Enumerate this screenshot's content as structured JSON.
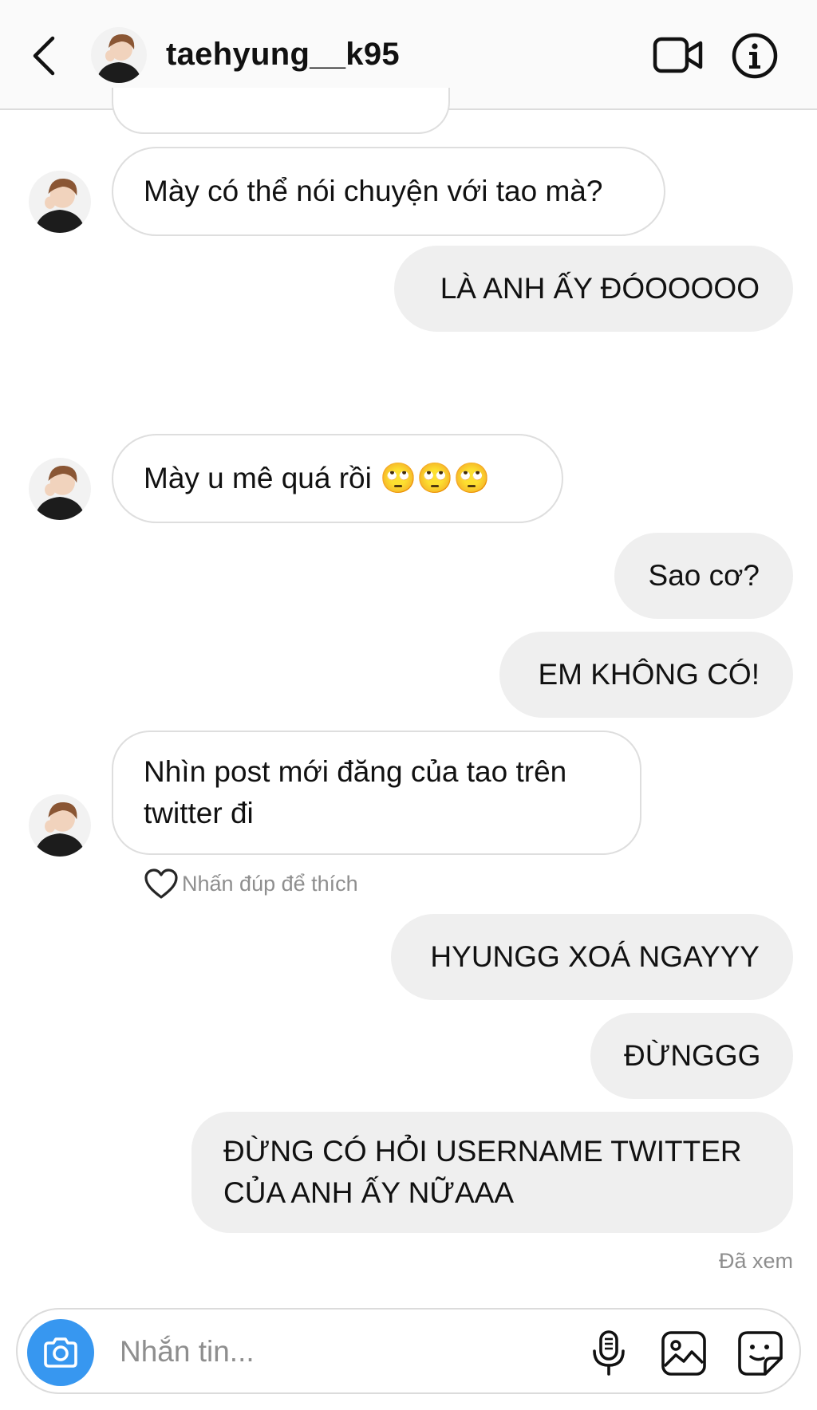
{
  "header": {
    "username": "taehyung__k95"
  },
  "messages": [
    {
      "direction": "in",
      "text": "Mày có thể nói chuyện với tao mà?"
    },
    {
      "direction": "out",
      "text": "LÀ ANH ẤY ĐÓOOOOO"
    },
    {
      "direction": "in",
      "text": "Mày u mê quá rồi 🙄🙄🙄"
    },
    {
      "direction": "out",
      "text": "Sao cơ?"
    },
    {
      "direction": "out",
      "text": "EM KHÔNG CÓ!"
    },
    {
      "direction": "in",
      "line1": "Nhìn post mới đăng của tao trên",
      "line2": "twitter đi"
    },
    {
      "direction": "out",
      "text": "HYUNGG XOÁ NGAYYY"
    },
    {
      "direction": "out",
      "text": "ĐỪNGGG"
    },
    {
      "direction": "out",
      "line1": "ĐỪNG CÓ HỎI USERNAME TWITTER",
      "line2": "CỦA ANH ẤY NỮAAA"
    }
  ],
  "like_hint": "Nhấn đúp để thích",
  "seen_status": "Đã xem",
  "composer": {
    "placeholder": "Nhắn tin..."
  },
  "colors": {
    "accent": "#3797f0",
    "outgoing_bubble": "#efefef",
    "secondary_text": "#8e8e8e"
  },
  "icons": [
    "back-arrow-icon",
    "video-call-icon",
    "info-icon",
    "heart-icon",
    "camera-icon",
    "microphone-icon",
    "gallery-icon",
    "sticker-icon"
  ]
}
